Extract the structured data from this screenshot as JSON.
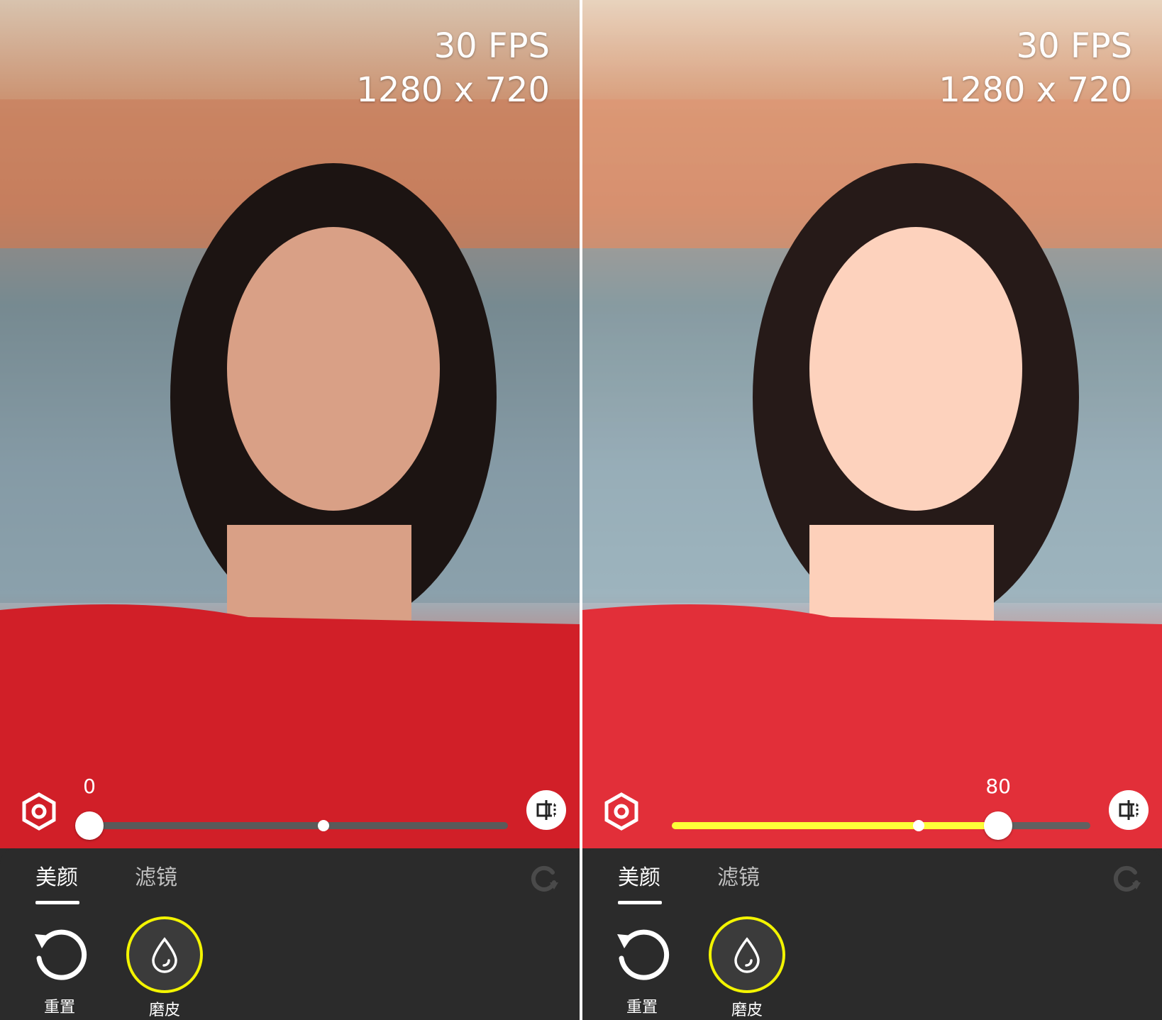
{
  "panels": [
    {
      "id": "before",
      "fps_label": "30 FPS",
      "resolution_label": "1280 x 720",
      "slider": {
        "value_label": "0",
        "value_fraction": 0.0,
        "default_fraction": 0.56
      },
      "tabs": [
        {
          "label": "美颜",
          "active": true
        },
        {
          "label": "滤镜",
          "active": false
        }
      ],
      "tools": [
        {
          "label": "重置",
          "icon": "reset-icon"
        },
        {
          "label": "磨皮",
          "icon": "smooth-skin-drop-icon",
          "selected": true
        }
      ]
    },
    {
      "id": "after",
      "fps_label": "30 FPS",
      "resolution_label": "1280 x 720",
      "slider": {
        "value_label": "80",
        "value_fraction": 0.78,
        "default_fraction": 0.59
      },
      "tabs": [
        {
          "label": "美颜",
          "active": true
        },
        {
          "label": "滤镜",
          "active": false
        }
      ],
      "tools": [
        {
          "label": "重置",
          "icon": "reset-icon"
        },
        {
          "label": "磨皮",
          "icon": "smooth-skin-drop-icon",
          "selected": true
        }
      ]
    }
  ],
  "colors": {
    "accent_yellow": "#ffff2b",
    "panel_dark": "#2b2b2b",
    "track_gray": "#5a5a5a"
  }
}
